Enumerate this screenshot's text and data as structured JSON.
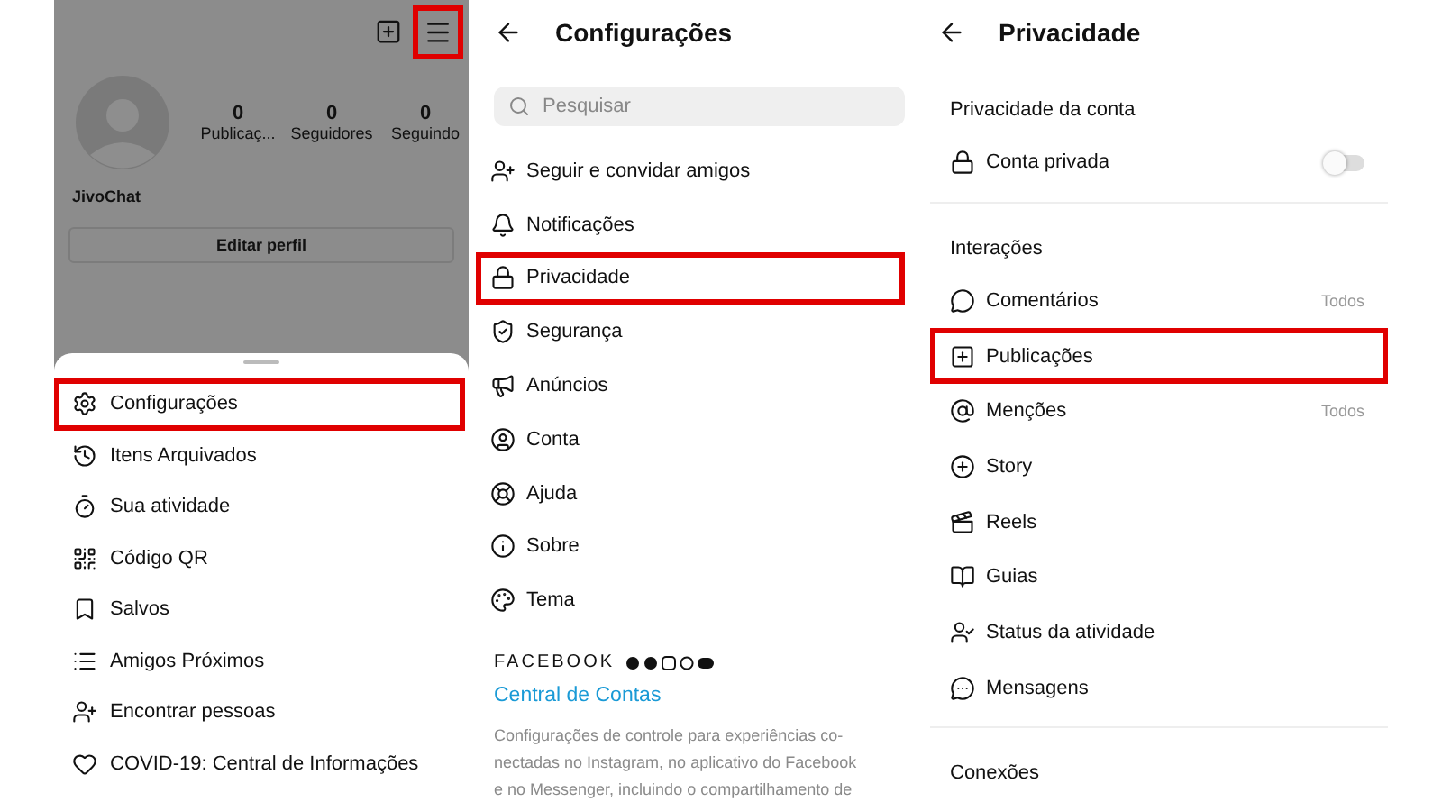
{
  "profile": {
    "menu_highlighted": true,
    "username": "JivoChat",
    "edit_button": "Editar perfil",
    "stats": [
      {
        "value": "0",
        "label": "Publicaç..."
      },
      {
        "value": "0",
        "label": "Seguidores"
      },
      {
        "value": "0",
        "label": "Seguindo"
      }
    ]
  },
  "menu_sheet": {
    "items": [
      {
        "kind": "gear",
        "label": "Configurações",
        "highlighted": true
      },
      {
        "kind": "history",
        "label": "Itens Arquivados",
        "highlighted": false
      },
      {
        "kind": "timer",
        "label": "Sua atividade",
        "highlighted": false
      },
      {
        "kind": "qr",
        "label": "Código QR",
        "highlighted": false
      },
      {
        "kind": "bookmark",
        "label": "Salvos",
        "highlighted": false
      },
      {
        "kind": "list",
        "label": "Amigos Próximos",
        "highlighted": false
      },
      {
        "kind": "invite",
        "label": "Encontrar pessoas",
        "highlighted": false
      },
      {
        "kind": "heart",
        "label": "COVID-19: Central de Informações",
        "highlighted": false
      }
    ]
  },
  "settings": {
    "title": "Configurações",
    "search": {
      "placeholder": "Pesquisar"
    },
    "items": [
      {
        "kind": "invite",
        "label": "Seguir e convidar amigos",
        "highlighted": false
      },
      {
        "kind": "bell",
        "label": "Notificações",
        "highlighted": false
      },
      {
        "kind": "lock",
        "label": "Privacidade",
        "highlighted": true
      },
      {
        "kind": "shield",
        "label": "Segurança",
        "highlighted": false
      },
      {
        "kind": "megaphone",
        "label": "Anúncios",
        "highlighted": false
      },
      {
        "kind": "account",
        "label": "Conta",
        "highlighted": false
      },
      {
        "kind": "lifebuoy",
        "label": "Ajuda",
        "highlighted": false
      },
      {
        "kind": "info",
        "label": "Sobre",
        "highlighted": false
      },
      {
        "kind": "palette",
        "label": "Tema",
        "highlighted": false
      }
    ],
    "brand": "FACEBOOK",
    "accounts_link": "Central de Contas",
    "description_lines": [
      "Configurações de controle para experiências co-",
      "nectadas no Instagram, no aplicativo do Facebook",
      "e no Messenger, incluindo o compartilhamento de"
    ]
  },
  "privacy": {
    "title": "Privacidade",
    "sections": [
      {
        "heading": "Privacidade da conta",
        "items": [
          {
            "kind": "lock",
            "label": "Conta privada",
            "on": false,
            "highlighted": false
          }
        ]
      },
      {
        "heading": "Interações",
        "items": [
          {
            "kind": "comment",
            "label": "Comentários",
            "value": "Todos",
            "highlighted": false
          },
          {
            "kind": "post",
            "label": "Publicações",
            "highlighted": true
          },
          {
            "kind": "mention",
            "label": "Menções",
            "value": "Todos",
            "highlighted": false
          },
          {
            "kind": "story",
            "label": "Story",
            "highlighted": false
          },
          {
            "kind": "reels",
            "label": "Reels",
            "highlighted": false
          },
          {
            "kind": "guide",
            "label": "Guias",
            "highlighted": false
          },
          {
            "kind": "status",
            "label": "Status da atividade",
            "highlighted": false
          },
          {
            "kind": "messenger",
            "label": "Mensagens",
            "highlighted": false
          }
        ]
      },
      {
        "heading": "Conexões"
      }
    ]
  }
}
